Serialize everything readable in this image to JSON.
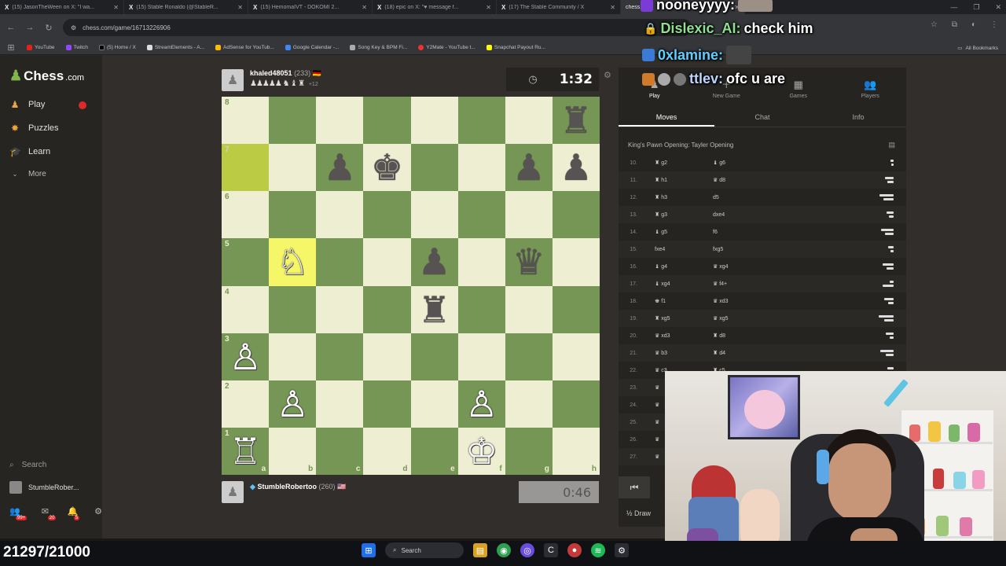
{
  "browser": {
    "tabs": [
      {
        "title": "(15) JasonTheWeen on X: \"I wa...",
        "active": false
      },
      {
        "title": "(15) Stable Ronaldo (@StableR...",
        "active": false
      },
      {
        "title": "(15) HemomaIVT - DOKOMI 2...",
        "active": false
      },
      {
        "title": "(18) epic on X: \"♥ message f...",
        "active": false
      },
      {
        "title": "(17) The Stable Community / X",
        "active": false
      },
      {
        "title": "chess.com",
        "active": true
      }
    ],
    "url": "chess.com/game/16713226906",
    "bookmarks": [
      "YouTube",
      "Twitch",
      "(5) Home / X",
      "StreamElements - A...",
      "AdSense for YouTub...",
      "Google Calendar -...",
      "Song Key & BPM Fi...",
      "Y2Mate - YouTube t...",
      "Snapchat Payout Ru..."
    ],
    "all_bookmarks": "All Bookmarks"
  },
  "sidebar": {
    "logo": "Chess",
    "logo_suffix": ".com",
    "nav": [
      {
        "label": "Play",
        "icon": "play-pawn-icon"
      },
      {
        "label": "Puzzles",
        "icon": "puzzle-icon"
      },
      {
        "label": "Learn",
        "icon": "learn-icon"
      },
      {
        "label": "More",
        "icon": "chevron-down-icon"
      }
    ],
    "search": "Search",
    "username": "StumbleRober...",
    "notif_counts": [
      "99+",
      "20",
      "5"
    ]
  },
  "top_player": {
    "name": "khaled48051",
    "rating": "(233)",
    "captured": "♟♟♟♟♟ ♞ ♝ ♜",
    "advantage": "+12",
    "clock": "1:32"
  },
  "bottom_player": {
    "name": "StumbleRobertoo",
    "rating": "(260)",
    "clock": "0:46"
  },
  "board": {
    "ranks": [
      "8",
      "7",
      "6",
      "5",
      "4",
      "3",
      "2",
      "1"
    ],
    "files": [
      "a",
      "b",
      "c",
      "d",
      "e",
      "f",
      "g",
      "h"
    ],
    "squares": [
      [
        "",
        "",
        "",
        "",
        "",
        "",
        "",
        "♜b"
      ],
      [
        "",
        "",
        "♟b",
        "♚b",
        "",
        "",
        "♟b",
        "♟b"
      ],
      [
        "",
        "",
        "",
        "",
        "",
        "",
        "",
        ""
      ],
      [
        "",
        "♘w",
        "",
        "",
        "♟b",
        "",
        "♛b",
        ""
      ],
      [
        "",
        "",
        "",
        "",
        "♜b",
        "",
        "",
        ""
      ],
      [
        "♙w",
        "",
        "",
        "",
        "",
        "",
        "",
        ""
      ],
      [
        "",
        "♙w",
        "",
        "",
        "",
        "♙w",
        "",
        ""
      ],
      [
        "♖w",
        "",
        "",
        "",
        "",
        "♔w",
        "",
        ""
      ]
    ],
    "highlights": [
      "a7",
      "b5"
    ]
  },
  "panel": {
    "top_tabs": [
      {
        "label": "Play",
        "icon": "play-icon"
      },
      {
        "label": "New Game",
        "icon": "plus-icon"
      },
      {
        "label": "Games",
        "icon": "games-icon"
      },
      {
        "label": "Players",
        "icon": "players-icon"
      }
    ],
    "sub_tabs": [
      "Moves",
      "Chat",
      "Info"
    ],
    "opening": "King's Pawn Opening: Tayler Opening",
    "moves": [
      {
        "num": "10.",
        "white": "♜ g2",
        "black": "♝ g6"
      },
      {
        "num": "11.",
        "white": "♜ h1",
        "black": "♛ d8"
      },
      {
        "num": "12.",
        "white": "♜ h3",
        "black": "d5"
      },
      {
        "num": "13.",
        "white": "♜ g3",
        "black": "dxe4"
      },
      {
        "num": "14.",
        "white": "♝ g5",
        "black": "f6"
      },
      {
        "num": "15.",
        "white": "fxe4",
        "black": "fxg5"
      },
      {
        "num": "16.",
        "white": "♝ g4",
        "black": "♛ xg4"
      },
      {
        "num": "17.",
        "white": "♝ xg4",
        "black": "♛ f4+"
      },
      {
        "num": "18.",
        "white": "♚ f1",
        "black": "♛ xd3"
      },
      {
        "num": "19.",
        "white": "♜ xg5",
        "black": "♛ xg5"
      },
      {
        "num": "20.",
        "white": "♛ xd3",
        "black": "♜ d8"
      },
      {
        "num": "21.",
        "white": "♛ b3",
        "black": "♜ d4"
      },
      {
        "num": "22.",
        "white": "♛ c3",
        "black": "♜ c5"
      },
      {
        "num": "23.",
        "white": "♛",
        "black": ""
      },
      {
        "num": "24.",
        "white": "♛",
        "black": ""
      },
      {
        "num": "25.",
        "white": "♛",
        "black": ""
      },
      {
        "num": "26.",
        "white": "♛",
        "black": ""
      },
      {
        "num": "27.",
        "white": "♛",
        "black": ""
      }
    ],
    "first_button": "⏮",
    "draw": "½ Draw"
  },
  "stream": {
    "chat": [
      {
        "user": "nooneyyyy:",
        "text": "",
        "color": "#ffffff"
      },
      {
        "user": "Dislexic_AI:",
        "text": "check him",
        "color": "#8fe08f"
      },
      {
        "user": "0xlamine:",
        "text": "",
        "color": "#5fd0ff"
      },
      {
        "user": "ttlev:",
        "text": "ofc u are",
        "color": "#bcd6ff"
      }
    ],
    "sub_counter": "21297/21000",
    "taskbar_search": "Search"
  }
}
